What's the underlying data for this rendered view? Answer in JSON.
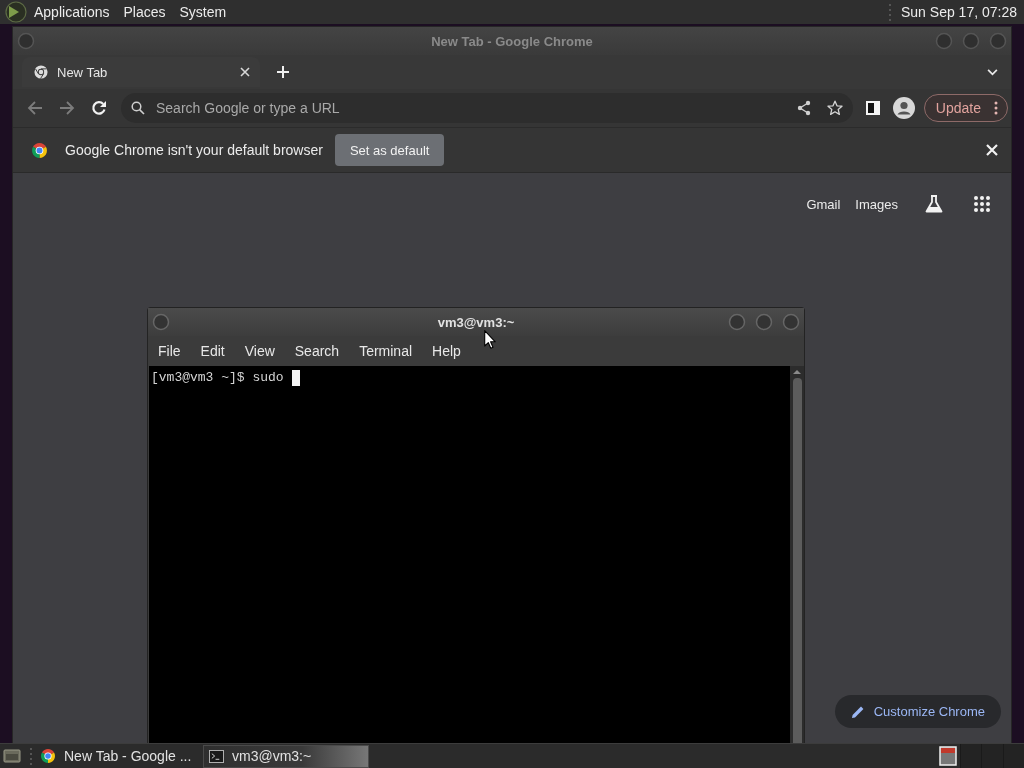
{
  "top_panel": {
    "menus": [
      "Applications",
      "Places",
      "System"
    ],
    "clock": "Sun Sep 17, 07:28"
  },
  "browser": {
    "title": "New Tab - Google Chrome",
    "tabs": [
      {
        "label": "New Tab",
        "selected": true
      }
    ],
    "nav_buttons": [
      {
        "kind": "back",
        "disabled": true
      },
      {
        "kind": "forward",
        "disabled": true
      },
      {
        "kind": "reload",
        "disabled": false
      }
    ],
    "omnibox": {
      "placeholder": "Search Google or type a URL"
    },
    "update_button": "Update",
    "infobar": {
      "message": "Google Chrome isn't your default browser",
      "button": "Set as default"
    },
    "new_tab_page": {
      "links": [
        "Gmail",
        "Images"
      ],
      "customize_button": "Customize Chrome"
    }
  },
  "terminal": {
    "title": "vm3@vm3:~",
    "menus": [
      "File",
      "Edit",
      "View",
      "Search",
      "Terminal",
      "Help"
    ],
    "prompt": "[vm3@vm3 ~]$ sudo"
  },
  "taskbar": {
    "tasks": [
      {
        "kind": "browser",
        "label": "New Tab - Google ...",
        "selected": false
      },
      {
        "kind": "terminal",
        "label": "vm3@vm3:~",
        "selected": true
      }
    ]
  }
}
